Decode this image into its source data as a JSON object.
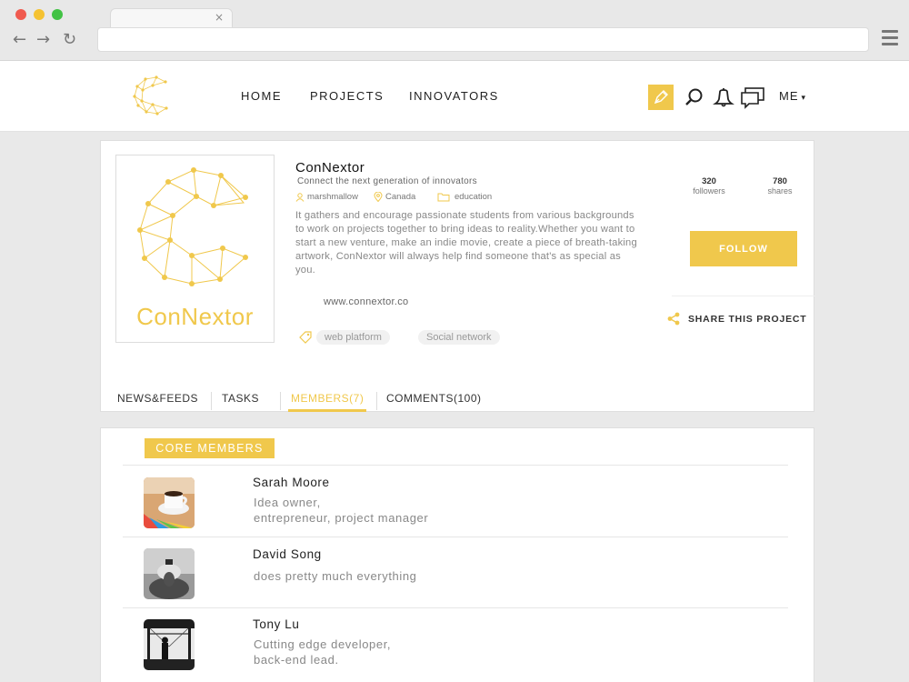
{
  "browser": {
    "tab_close": "×",
    "back": "←",
    "forward": "→",
    "reload": "↻",
    "dot_colors": [
      "#f05a4f",
      "#f5c231",
      "#42c244"
    ]
  },
  "nav": {
    "links": [
      "HOME",
      "PROJECTS",
      "INNOVATORS"
    ],
    "me_label": "ME",
    "me_caret": "▾",
    "accent": "#f0c84c"
  },
  "project": {
    "logo_text": "ConNextor",
    "title": "ConNextor",
    "tagline": "Connect the next generation of innovators",
    "owner": "marshmallow",
    "location": "Canada",
    "category": "education",
    "description": "It gathers and encourage passionate students from various backgrounds to work on projects together to bring ideas to reality.Whether you want to start a new venture, make an indie movie, create a piece of breath-taking artwork, ConNextor will always help find someone that's as special as you.",
    "url": "www.connextor.co",
    "tags": [
      "web platform",
      "Social network"
    ],
    "followers_count": "320",
    "followers_label": "followers",
    "shares_count": "780",
    "shares_label": "shares",
    "follow_label": "FOLLOW",
    "share_label": "SHARE THIS PROJECT",
    "tabs": [
      "NEWS&FEEDS",
      "TASKS",
      "MEMBERS(7)",
      "COMMENTS(100)"
    ],
    "active_tab": "MEMBERS(7)"
  },
  "members": {
    "section_label": "CORE MEMBERS",
    "list": [
      {
        "name": "Sarah Moore",
        "role_line1": "Idea owner,",
        "role_line2": "entrepreneur, project manager"
      },
      {
        "name": "David Song",
        "role_line1": "does pretty much everything",
        "role_line2": ""
      },
      {
        "name": "Tony Lu",
        "role_line1": "Cutting edge developer,",
        "role_line2": "back-end lead."
      }
    ]
  }
}
